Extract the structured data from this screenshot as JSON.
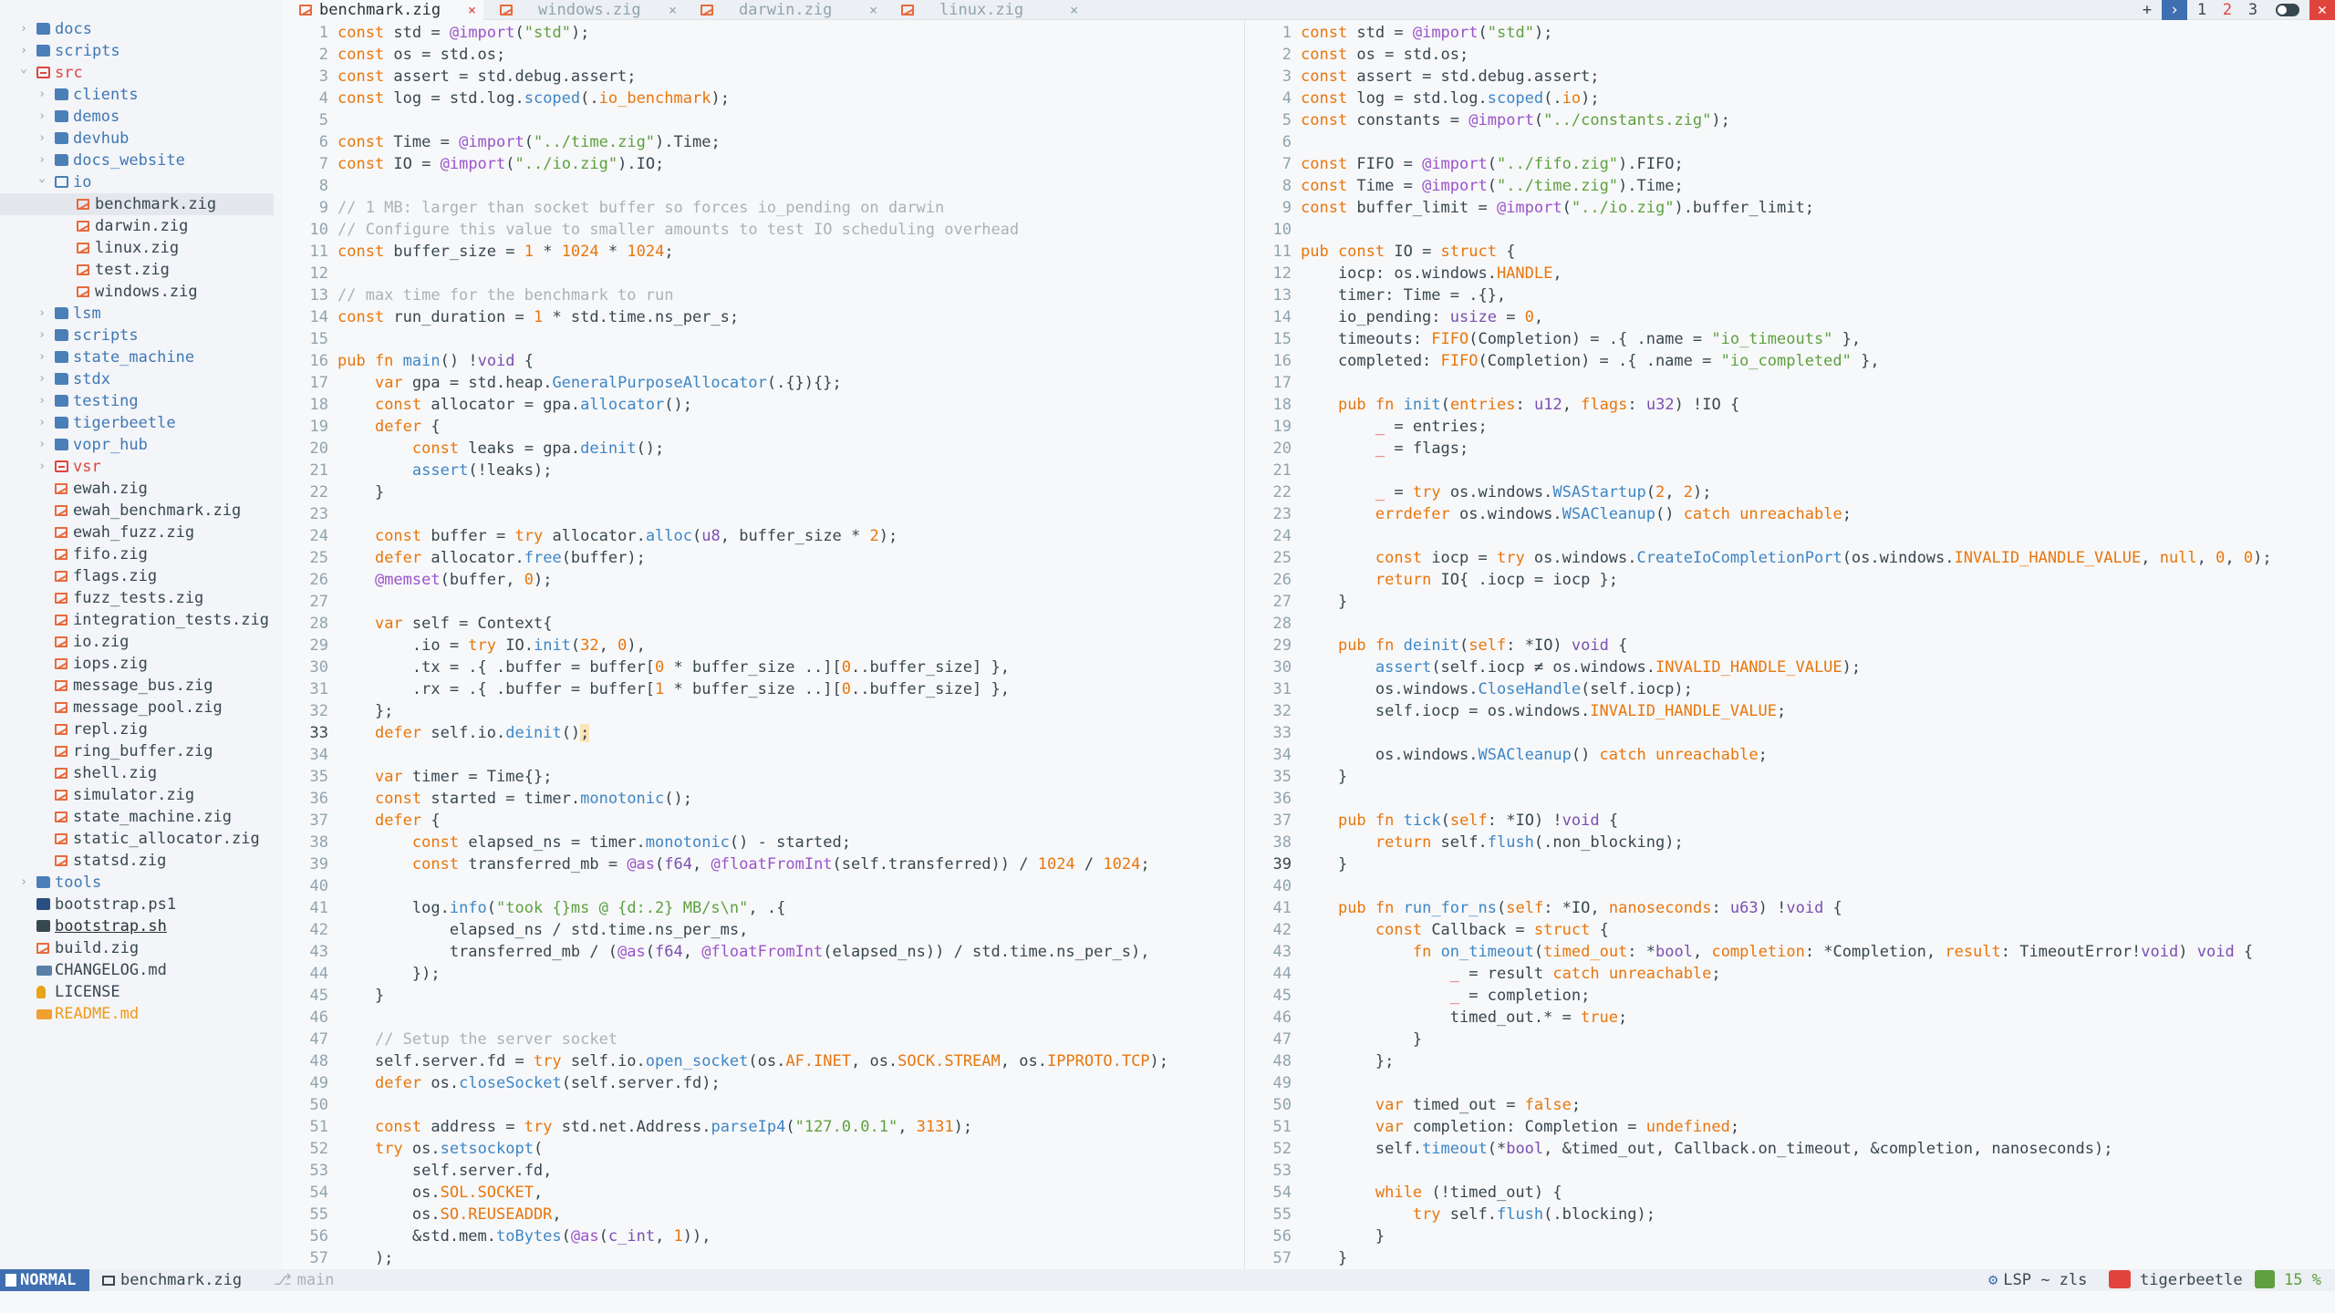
{
  "sidebar": {
    "items": [
      {
        "label": "docs",
        "icon": "folder-icon",
        "kind": "folder",
        "depth": 0,
        "expanded": false
      },
      {
        "label": "scripts",
        "icon": "folder-icon",
        "kind": "folder",
        "depth": 0,
        "expanded": false
      },
      {
        "label": "src",
        "icon": "folder-open-icon",
        "kind": "folder-red",
        "depth": 0,
        "expanded": true
      },
      {
        "label": "clients",
        "icon": "folder-icon",
        "kind": "folder",
        "depth": 1,
        "expanded": false
      },
      {
        "label": "demos",
        "icon": "folder-icon",
        "kind": "folder",
        "depth": 1,
        "expanded": false
      },
      {
        "label": "devhub",
        "icon": "folder-icon",
        "kind": "folder",
        "depth": 1,
        "expanded": false
      },
      {
        "label": "docs_website",
        "icon": "folder-icon",
        "kind": "folder",
        "depth": 1,
        "expanded": false
      },
      {
        "label": "io",
        "icon": "folder-open-icon",
        "kind": "folder-open",
        "depth": 1,
        "expanded": true
      },
      {
        "label": "benchmark.zig",
        "icon": "zig-file-icon",
        "kind": "zig",
        "depth": 2,
        "selected": true
      },
      {
        "label": "darwin.zig",
        "icon": "zig-file-icon",
        "kind": "zig",
        "depth": 2
      },
      {
        "label": "linux.zig",
        "icon": "zig-file-icon",
        "kind": "zig",
        "depth": 2
      },
      {
        "label": "test.zig",
        "icon": "zig-file-icon",
        "kind": "zig",
        "depth": 2
      },
      {
        "label": "windows.zig",
        "icon": "zig-file-icon",
        "kind": "zig",
        "depth": 2
      },
      {
        "label": "lsm",
        "icon": "folder-icon",
        "kind": "folder",
        "depth": 1,
        "expanded": false
      },
      {
        "label": "scripts",
        "icon": "folder-icon",
        "kind": "folder",
        "depth": 1,
        "expanded": false
      },
      {
        "label": "state_machine",
        "icon": "folder-icon",
        "kind": "folder",
        "depth": 1,
        "expanded": false
      },
      {
        "label": "stdx",
        "icon": "folder-icon",
        "kind": "folder",
        "depth": 1,
        "expanded": false
      },
      {
        "label": "testing",
        "icon": "folder-icon",
        "kind": "folder",
        "depth": 1,
        "expanded": false
      },
      {
        "label": "tigerbeetle",
        "icon": "folder-icon",
        "kind": "folder",
        "depth": 1,
        "expanded": false
      },
      {
        "label": "vopr_hub",
        "icon": "folder-icon",
        "kind": "folder",
        "depth": 1,
        "expanded": false
      },
      {
        "label": "vsr",
        "icon": "folder-red-icon",
        "kind": "folder-red",
        "depth": 1,
        "expanded": false
      },
      {
        "label": "ewah.zig",
        "icon": "zig-file-icon",
        "kind": "zig",
        "depth": 1
      },
      {
        "label": "ewah_benchmark.zig",
        "icon": "zig-file-icon",
        "kind": "zig",
        "depth": 1
      },
      {
        "label": "ewah_fuzz.zig",
        "icon": "zig-file-icon",
        "kind": "zig",
        "depth": 1
      },
      {
        "label": "fifo.zig",
        "icon": "zig-file-icon",
        "kind": "zig",
        "depth": 1
      },
      {
        "label": "flags.zig",
        "icon": "zig-file-icon",
        "kind": "zig",
        "depth": 1
      },
      {
        "label": "fuzz_tests.zig",
        "icon": "zig-file-icon",
        "kind": "zig",
        "depth": 1
      },
      {
        "label": "integration_tests.zig",
        "icon": "zig-file-icon",
        "kind": "zig",
        "depth": 1
      },
      {
        "label": "io.zig",
        "icon": "zig-file-icon",
        "kind": "zig",
        "depth": 1
      },
      {
        "label": "iops.zig",
        "icon": "zig-file-icon",
        "kind": "zig",
        "depth": 1
      },
      {
        "label": "message_bus.zig",
        "icon": "zig-file-icon",
        "kind": "zig",
        "depth": 1
      },
      {
        "label": "message_pool.zig",
        "icon": "zig-file-icon",
        "kind": "zig",
        "depth": 1
      },
      {
        "label": "repl.zig",
        "icon": "zig-file-icon",
        "kind": "zig",
        "depth": 1
      },
      {
        "label": "ring_buffer.zig",
        "icon": "zig-file-icon",
        "kind": "zig",
        "depth": 1
      },
      {
        "label": "shell.zig",
        "icon": "zig-file-icon",
        "kind": "zig",
        "depth": 1
      },
      {
        "label": "simulator.zig",
        "icon": "zig-file-icon",
        "kind": "zig",
        "depth": 1
      },
      {
        "label": "state_machine.zig",
        "icon": "zig-file-icon",
        "kind": "zig",
        "depth": 1
      },
      {
        "label": "static_allocator.zig",
        "icon": "zig-file-icon",
        "kind": "zig",
        "depth": 1
      },
      {
        "label": "statsd.zig",
        "icon": "zig-file-icon",
        "kind": "zig",
        "depth": 1
      },
      {
        "label": "tools",
        "icon": "folder-icon",
        "kind": "folder",
        "depth": 0,
        "expanded": false
      },
      {
        "label": "bootstrap.ps1",
        "icon": "powershell-icon",
        "kind": "ps",
        "depth": 0
      },
      {
        "label": "bootstrap.sh",
        "icon": "shell-script-icon",
        "kind": "sh",
        "depth": 0
      },
      {
        "label": "build.zig",
        "icon": "zig-file-icon",
        "kind": "zig",
        "depth": 0
      },
      {
        "label": "CHANGELOG.md",
        "icon": "markdown-icon",
        "kind": "md",
        "depth": 0
      },
      {
        "label": "LICENSE",
        "icon": "license-icon",
        "kind": "lic",
        "depth": 0
      },
      {
        "label": "README.md",
        "icon": "markdown-icon",
        "kind": "md-orange",
        "depth": 0
      }
    ]
  },
  "tabs": [
    {
      "label": "benchmark.zig",
      "active": true,
      "close": "×"
    },
    {
      "label": "windows.zig",
      "active": false,
      "close": "×"
    },
    {
      "label": "darwin.zig",
      "active": false,
      "close": "×"
    },
    {
      "label": "linux.zig",
      "active": false,
      "close": "×"
    }
  ],
  "tab_controls": {
    "plus": "+",
    "chevron": "›",
    "tab1": "1",
    "tab2": "2",
    "tab3": "3",
    "close": "✕"
  },
  "editor_left": {
    "current_line": 33,
    "lines": [
      "1|@@k:const@@ std = @@b:@import@@(@@s:\"std\"@@);",
      "2|@@k:const@@ os = std.os;",
      "3|@@k:const@@ assert = std.debug.assert;",
      "4|@@k:const@@ log = std.log.@@fn:scoped@@(.@@f:io_benchmark@@);",
      "5|",
      "6|@@k:const@@ Time = @@b:@import@@(@@s:\"../time.zig\"@@).Time;",
      "7|@@k:const@@ IO = @@b:@import@@(@@s:\"../io.zig\"@@).IO;",
      "8|",
      "9|@@cm:// 1 MB: larger than socket buffer so forces io_pending on darwin@@",
      "10|@@cm:// Configure this value to smaller amounts to test IO scheduling overhead@@",
      "11|@@k:const@@ buffer_size = @@n:1@@ * @@n:1024@@ * @@n:1024@@;",
      "12|",
      "13|@@cm:// max time for the benchmark to run@@",
      "14|@@k:const@@ run_duration = @@n:1@@ * std.time.ns_per_s;",
      "15|",
      "16|@@k:pub fn@@ @@fn:main@@() !@@t:void@@ {",
      "17|    @@k:var@@ gpa = std.heap.@@fn:GeneralPurposeAllocator@@(.{}){};",
      "18|    @@k:const@@ allocator = gpa.@@fn:allocator@@();",
      "19|    @@k:defer@@ {",
      "20|        @@k:const@@ leaks = gpa.@@fn:deinit@@();",
      "21|        @@fn:assert@@(!leaks);",
      "22|    }",
      "23|",
      "24|    @@k:const@@ buffer = @@k:try@@ allocator.@@fn:alloc@@(@@t:u8@@, buffer_size * @@n:2@@);",
      "25|    @@k:defer@@ allocator.@@fn:free@@(buffer);",
      "26|    @@b:@memset@@(buffer, @@n:0@@);",
      "27|",
      "28|    @@k:var@@ self = Context{",
      "29|        .io = @@k:try@@ IO.@@fn:init@@(@@n:32@@, @@n:0@@),",
      "30|        .tx = .{ .buffer = buffer[@@n:0@@ * buffer_size ..][@@n:0@@..buffer_size] },",
      "31|        .rx = .{ .buffer = buffer[@@n:1@@ * buffer_size ..][@@n:0@@..buffer_size] },",
      "32|    };",
      "33|    @@k:defer@@ self.io.@@fn:deinit@@()@@cur:;@@",
      "34|",
      "35|    @@k:var@@ timer = Time{};",
      "36|    @@k:const@@ started = timer.@@fn:monotonic@@();",
      "37|    @@k:defer@@ {",
      "38|        @@k:const@@ elapsed_ns = timer.@@fn:monotonic@@() - started;",
      "39|        @@k:const@@ transferred_mb = @@b:@as@@(@@t:f64@@, @@b:@floatFromInt@@(self.transferred)) / @@n:1024@@ / @@n:1024@@;",
      "40|",
      "41|        log.@@fn:info@@(@@s:\"took {}ms @ {d:.2} MB/s\\n\"@@, .{",
      "42|            elapsed_ns / std.time.ns_per_ms,",
      "43|            transferred_mb / (@@b:@as@@(@@t:f64@@, @@b:@floatFromInt@@(elapsed_ns)) / std.time.ns_per_s),",
      "44|        });",
      "45|    }",
      "46|",
      "47|    @@cm:// Setup the server socket@@",
      "48|    self.server.fd = @@k:try@@ self.io.@@fn:open_socket@@(os.@@cst:AF.INET@@, os.@@cst:SOCK.STREAM@@, os.@@cst:IPPROTO.TCP@@);",
      "49|    @@k:defer@@ os.@@fn:closeSocket@@(self.server.fd);",
      "50|",
      "51|    @@k:const@@ address = @@k:try@@ std.net.Address.@@fn:parseIp4@@(@@s:\"127.0.0.1\"@@, @@n:3131@@);",
      "52|    @@k:try@@ os.@@fn:setsockopt@@(",
      "53|        self.server.fd,",
      "54|        os.@@cst:SOL.SOCKET@@,",
      "55|        os.@@cst:SO.REUSEADDR@@,",
      "56|        &std.mem.@@fn:toBytes@@(@@b:@as@@(@@t:c_int@@, @@n:1@@)),",
      "57|    );"
    ]
  },
  "editor_right": {
    "current_line": 39,
    "lines": [
      "1|@@k:const@@ std = @@b:@import@@(@@s:\"std\"@@);",
      "2|@@k:const@@ os = std.os;",
      "3|@@k:const@@ assert = std.debug.assert;",
      "4|@@k:const@@ log = std.log.@@fn:scoped@@(.@@f:io@@);",
      "5|@@k:const@@ constants = @@b:@import@@(@@s:\"../constants.zig\"@@);",
      "6|",
      "7|@@k:const@@ FIFO = @@b:@import@@(@@s:\"../fifo.zig\"@@).FIFO;",
      "8|@@k:const@@ Time = @@b:@import@@(@@s:\"../time.zig\"@@).Time;",
      "9|@@k:const@@ buffer_limit = @@b:@import@@(@@s:\"../io.zig\"@@).buffer_limit;",
      "10|",
      "11|@@k:pub const@@ IO = @@k:struct@@ {",
      "12|    iocp: os.windows.@@cst:HANDLE@@,",
      "13|    timer: Time = .{},",
      "14|    io_pending: @@t:usize@@ = @@n:0@@,",
      "15|    timeouts: @@f:FIFO@@(Completion) = .{ .name = @@s:\"io_timeouts\"@@ },",
      "16|    completed: @@f:FIFO@@(Completion) = .{ .name = @@s:\"io_completed\"@@ },",
      "17|",
      "18|    @@k:pub fn@@ @@fn:init@@(@@f:entries@@: @@t:u12@@, @@f:flags@@: @@t:u32@@) !IO {",
      "19|        @@u:_@@ = entries;",
      "20|        @@u:_@@ = flags;",
      "21|",
      "22|        @@u:_@@ = @@k:try@@ os.windows.@@fn:WSAStartup@@(@@n:2@@, @@n:2@@);",
      "23|        @@k:errdefer@@ os.windows.@@fn:WSACleanup@@() @@k:catch@@ @@k:unreachable@@;",
      "24|",
      "25|        @@k:const@@ iocp = @@k:try@@ os.windows.@@fn:CreateIoCompletionPort@@(os.windows.@@cst:INVALID_HANDLE_VALUE@@, @@k:null@@, @@n:0@@, @@n:0@@);",
      "26|        @@k:return@@ IO{ .iocp = iocp };",
      "27|    }",
      "28|",
      "29|    @@k:pub fn@@ @@fn:deinit@@(@@f:self@@: *IO) @@t:void@@ {",
      "30|        @@fn:assert@@(self.iocp ≠ os.windows.@@cst:INVALID_HANDLE_VALUE@@);",
      "31|        os.windows.@@fn:CloseHandle@@(self.iocp);",
      "32|        self.iocp = os.windows.@@cst:INVALID_HANDLE_VALUE@@;",
      "33|",
      "34|        os.windows.@@fn:WSACleanup@@() @@k:catch@@ @@k:unreachable@@;",
      "35|    }",
      "36|",
      "37|    @@k:pub fn@@ @@fn:tick@@(@@f:self@@: *IO) !@@t:void@@ {",
      "38|        @@k:return@@ self.@@fn:flush@@(.non_blocking);",
      "39|    }",
      "40|",
      "41|    @@k:pub fn@@ @@fn:run_for_ns@@(@@f:self@@: *IO, @@f:nanoseconds@@: @@t:u63@@) !@@t:void@@ {",
      "42|        @@k:const@@ Callback = @@k:struct@@ {",
      "43|            @@k:fn@@ @@fn:on_timeout@@(@@f:timed_out@@: *@@t:bool@@, @@f:completion@@: *Completion, @@f:result@@: TimeoutError!@@t:void@@) @@t:void@@ {",
      "44|                @@u:_@@ = result @@k:catch@@ @@k:unreachable@@;",
      "45|                @@u:_@@ = completion;",
      "46|                timed_out.* = @@k:true@@;",
      "47|            }",
      "48|        };",
      "49|",
      "50|        @@k:var@@ timed_out = @@k:false@@;",
      "51|        @@k:var@@ completion: Completion = @@k:undefined@@;",
      "52|        self.@@fn:timeout@@(*@@t:bool@@, &timed_out, Callback.on_timeout, &completion, nanoseconds);",
      "53|",
      "54|        @@k:while@@ (!timed_out) {",
      "55|            @@k:try@@ self.@@fn:flush@@(.blocking);",
      "56|        }",
      "57|    }"
    ]
  },
  "statusbar": {
    "mode": "NORMAL",
    "file": "benchmark.zig",
    "branch": "main",
    "lsp": "LSP ~ zls",
    "project": "tigerbeetle",
    "percent": "15 %",
    "colors": {
      "mode_bg": "#3f6fb0",
      "project_bg": "#e0443d",
      "percent_fg": "#5ea03f"
    }
  }
}
